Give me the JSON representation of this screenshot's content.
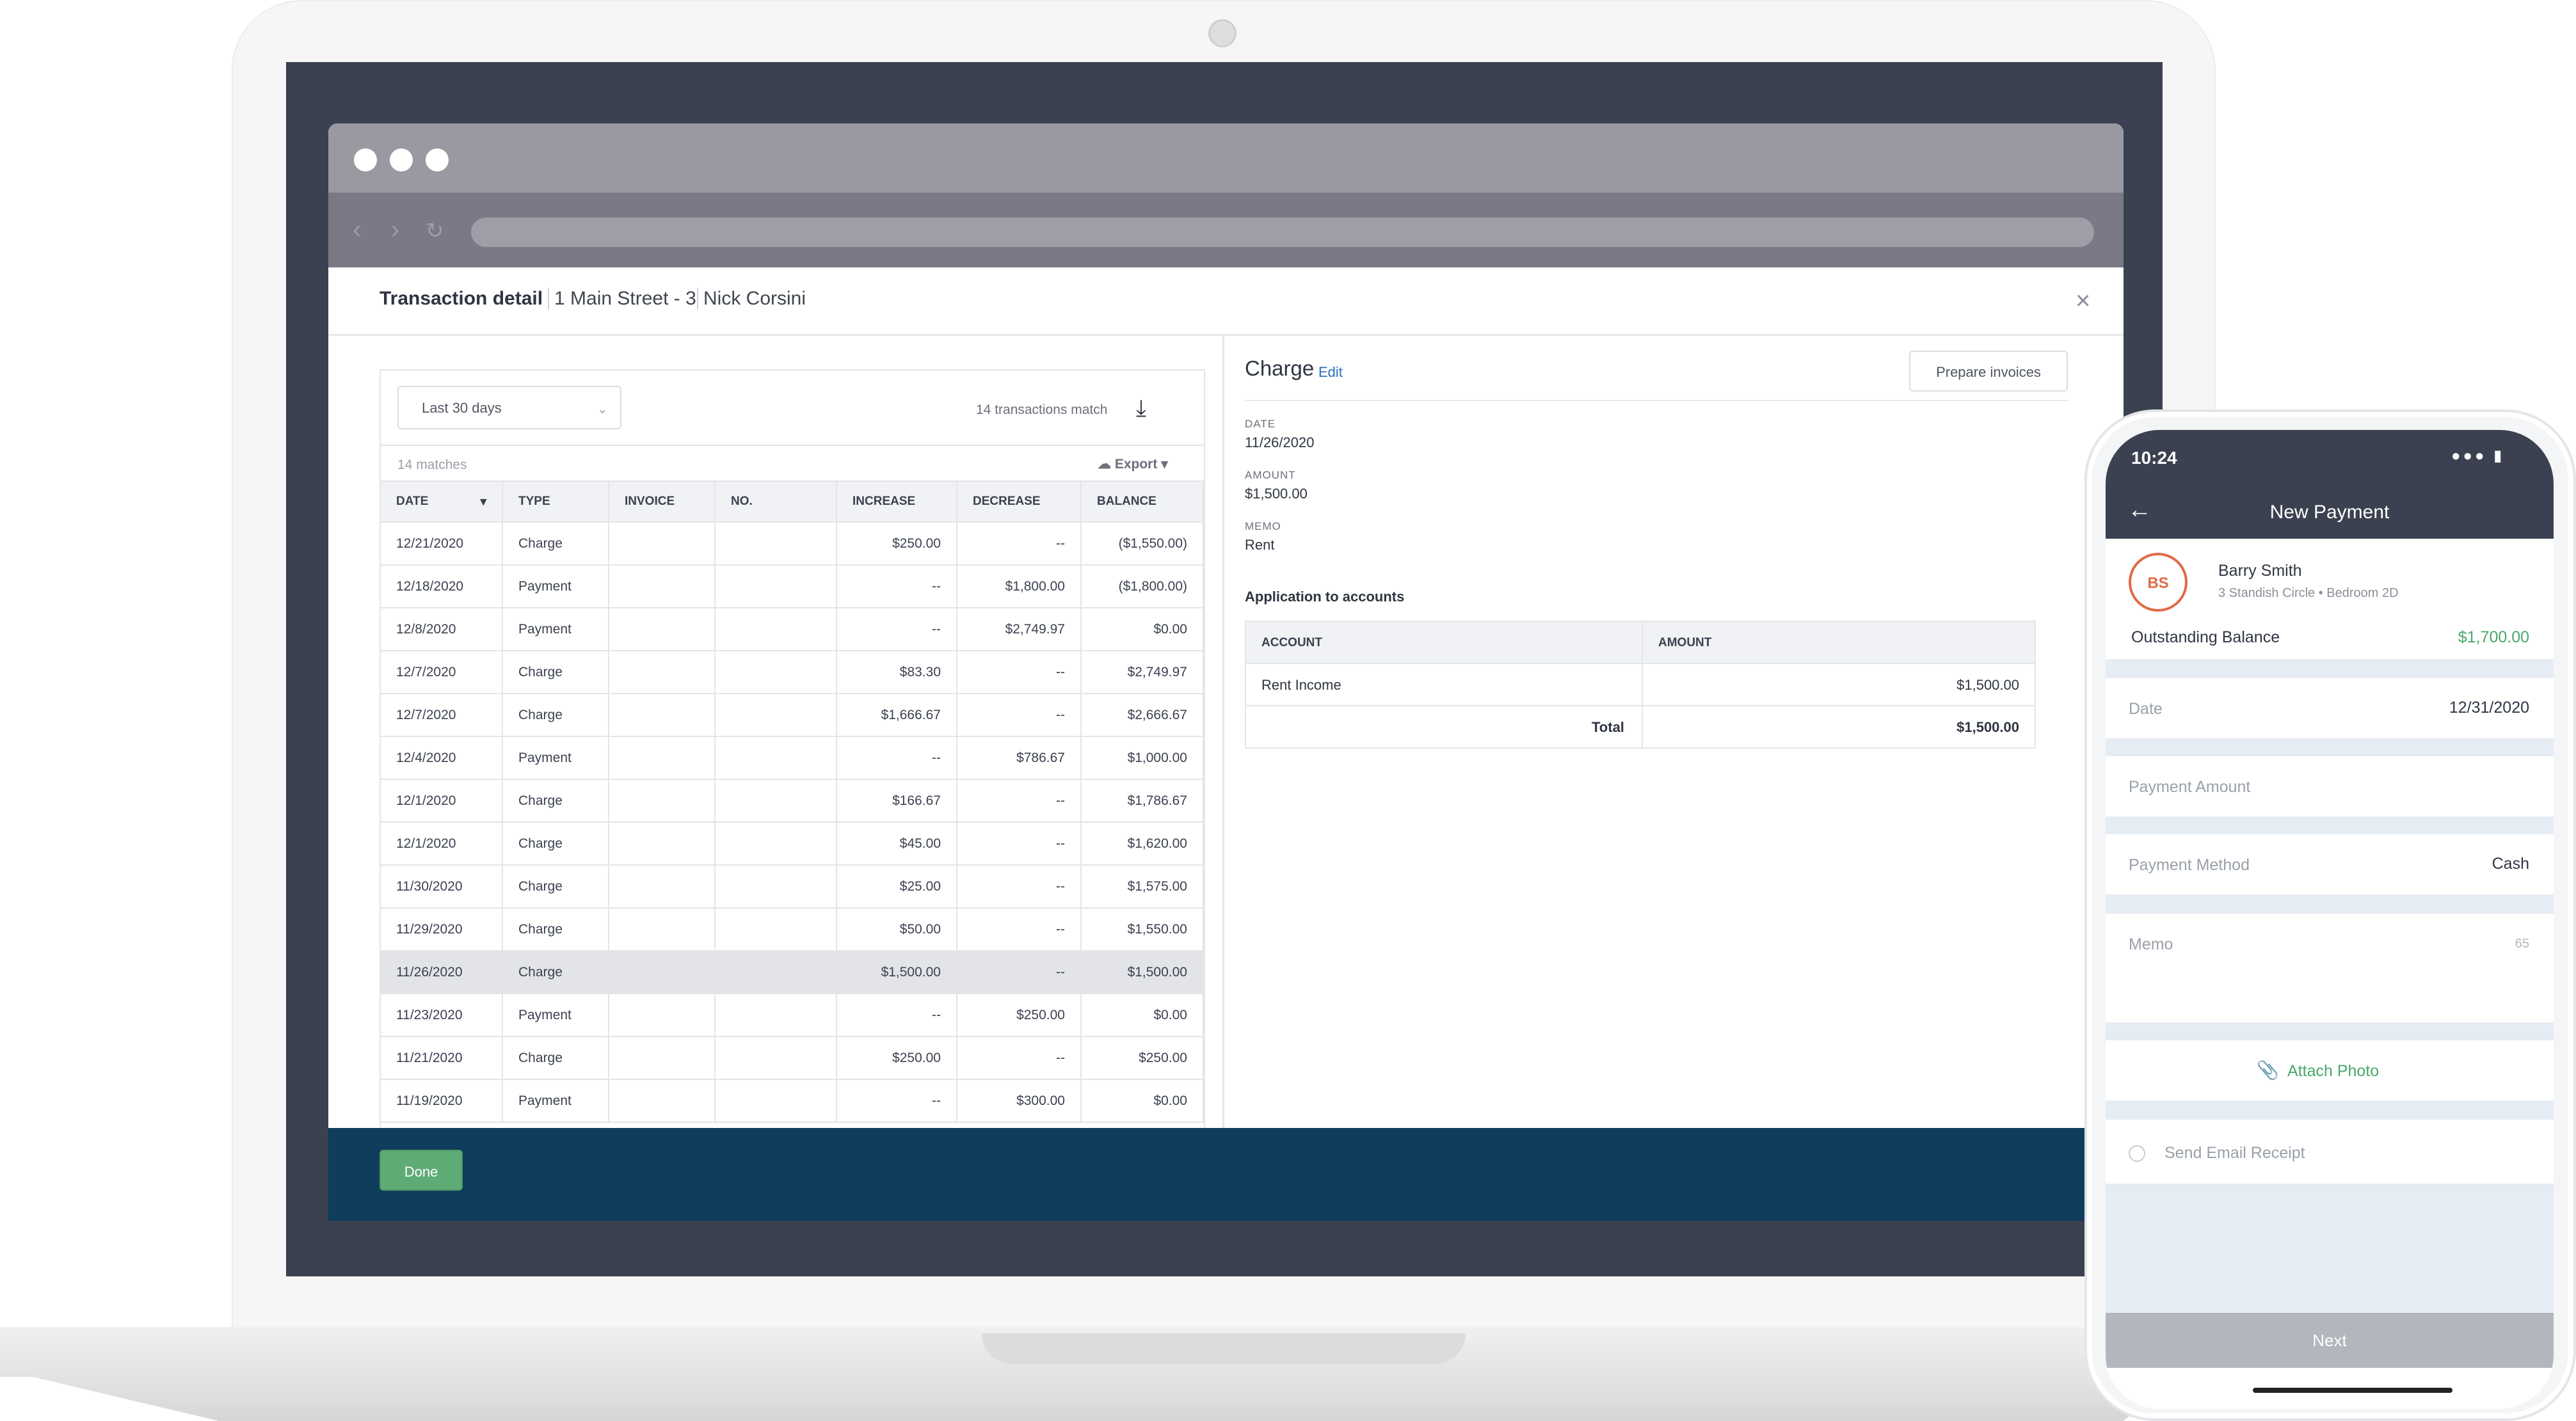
{
  "page_header": {
    "title": "Transaction detail",
    "property": "1 Main Street - 3",
    "tenant": "Nick Corsini",
    "close": "×"
  },
  "filters": {
    "range": "Last 30 days",
    "match_summary": "14 transactions match",
    "matches": "14 matches",
    "export": "Export"
  },
  "ledger": {
    "columns": [
      "DATE",
      "TYPE",
      "INVOICE",
      "NO.",
      "INCREASE",
      "DECREASE",
      "BALANCE"
    ],
    "rows": [
      {
        "date": "12/21/2020",
        "type": "Charge",
        "invoice": "",
        "no": "",
        "increase": "$250.00",
        "decrease": "--",
        "balance": "($1,550.00)"
      },
      {
        "date": "12/18/2020",
        "type": "Payment",
        "invoice": "",
        "no": "",
        "increase": "--",
        "decrease": "$1,800.00",
        "balance": "($1,800.00)"
      },
      {
        "date": "12/8/2020",
        "type": "Payment",
        "invoice": "",
        "no": "",
        "increase": "--",
        "decrease": "$2,749.97",
        "balance": "$0.00"
      },
      {
        "date": "12/7/2020",
        "type": "Charge",
        "invoice": "",
        "no": "",
        "increase": "$83.30",
        "decrease": "--",
        "balance": "$2,749.97"
      },
      {
        "date": "12/7/2020",
        "type": "Charge",
        "invoice": "",
        "no": "",
        "increase": "$1,666.67",
        "decrease": "--",
        "balance": "$2,666.67"
      },
      {
        "date": "12/4/2020",
        "type": "Payment",
        "invoice": "",
        "no": "",
        "increase": "--",
        "decrease": "$786.67",
        "balance": "$1,000.00"
      },
      {
        "date": "12/1/2020",
        "type": "Charge",
        "invoice": "",
        "no": "",
        "increase": "$166.67",
        "decrease": "--",
        "balance": "$1,786.67"
      },
      {
        "date": "12/1/2020",
        "type": "Charge",
        "invoice": "",
        "no": "",
        "increase": "$45.00",
        "decrease": "--",
        "balance": "$1,620.00"
      },
      {
        "date": "11/30/2020",
        "type": "Charge",
        "invoice": "",
        "no": "",
        "increase": "$25.00",
        "decrease": "--",
        "balance": "$1,575.00"
      },
      {
        "date": "11/29/2020",
        "type": "Charge",
        "invoice": "",
        "no": "",
        "increase": "$50.00",
        "decrease": "--",
        "balance": "$1,550.00"
      },
      {
        "date": "11/26/2020",
        "type": "Charge",
        "invoice": "",
        "no": "",
        "increase": "$1,500.00",
        "decrease": "--",
        "balance": "$1,500.00"
      },
      {
        "date": "11/23/2020",
        "type": "Payment",
        "invoice": "",
        "no": "",
        "increase": "--",
        "decrease": "$250.00",
        "balance": "$0.00"
      },
      {
        "date": "11/21/2020",
        "type": "Charge",
        "invoice": "",
        "no": "",
        "increase": "$250.00",
        "decrease": "--",
        "balance": "$250.00"
      },
      {
        "date": "11/19/2020",
        "type": "Payment",
        "invoice": "",
        "no": "",
        "increase": "--",
        "decrease": "$300.00",
        "balance": "$0.00"
      }
    ]
  },
  "detail": {
    "title": "Charge",
    "edit": "Edit",
    "prepare_invoices": "Prepare invoices",
    "date_label": "DATE",
    "date_value": "11/26/2020",
    "amount_label": "AMOUNT",
    "amount_value": "$1,500.00",
    "memo_label": "MEMO",
    "memo_value": "Rent",
    "application_title": "Application to accounts",
    "account_header": "ACCOUNT",
    "amount_header": "AMOUNT",
    "account_name": "Rent Income",
    "account_amount": "$1,500.00",
    "total_label": "Total",
    "total_value": "$1,500.00"
  },
  "footer": {
    "done": "Done"
  },
  "mobile": {
    "time": "10:24",
    "title": "New Payment",
    "avatar_initials": "BS",
    "tenant_name": "Barry Smith",
    "tenant_unit": "3 Standish Circle • Bedroom 2D",
    "outstanding_label": "Outstanding Balance",
    "outstanding_value": "$1,700.00",
    "date_label": "Date",
    "date_value": "12/31/2020",
    "payment_amount_label": "Payment Amount",
    "payment_method_label": "Payment Method",
    "payment_method_value": "Cash",
    "memo_label": "Memo",
    "memo_counter": "65",
    "attach_photo": "Attach Photo",
    "send_email_receipt": "Send Email Receipt",
    "next": "Next"
  },
  "colors": {
    "footer_bar": "#0f3d5c",
    "done_button": "#5eab76",
    "positive_green": "#4aa86b",
    "avatar_accent": "#e06a45",
    "link_blue": "#2a6ebd"
  }
}
